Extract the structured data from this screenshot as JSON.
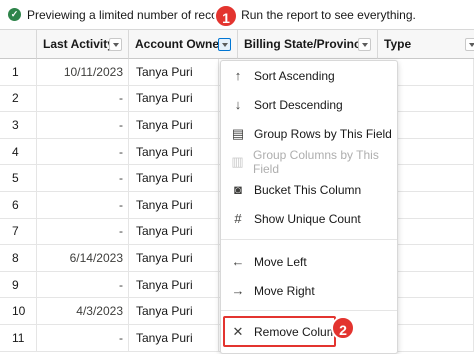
{
  "banner": {
    "message": "Previewing a limited number of records. Run the report to see everything."
  },
  "columns": {
    "last_activity": "Last Activity",
    "account_owner": "Account Owner",
    "billing_state": "Billing State/Province",
    "type": "Type"
  },
  "rows": [
    {
      "num": "1",
      "date": "10/11/2023",
      "owner": "Tanya Puri"
    },
    {
      "num": "2",
      "date": "-",
      "owner": "Tanya Puri"
    },
    {
      "num": "3",
      "date": "-",
      "owner": "Tanya Puri"
    },
    {
      "num": "4",
      "date": "-",
      "owner": "Tanya Puri"
    },
    {
      "num": "5",
      "date": "-",
      "owner": "Tanya Puri"
    },
    {
      "num": "6",
      "date": "-",
      "owner": "Tanya Puri"
    },
    {
      "num": "7",
      "date": "-",
      "owner": "Tanya Puri"
    },
    {
      "num": "8",
      "date": "6/14/2023",
      "owner": "Tanya Puri"
    },
    {
      "num": "9",
      "date": "-",
      "owner": "Tanya Puri"
    },
    {
      "num": "10",
      "date": "4/3/2023",
      "owner": "Tanya Puri"
    },
    {
      "num": "11",
      "date": "-",
      "owner": "Tanya Puri"
    }
  ],
  "menu": {
    "sort_ascending": "Sort Ascending",
    "sort_descending": "Sort Descending",
    "group_rows": "Group Rows by This Field",
    "group_columns": "Group Columns by This Field",
    "bucket": "Bucket This Column",
    "unique_count": "Show Unique Count",
    "move_left": "Move Left",
    "move_right": "Move Right",
    "remove_column": "Remove Column"
  },
  "callouts": {
    "step1": "1",
    "step2": "2"
  },
  "icons": {
    "banner": "check-circle-icon",
    "header_dropdown": "chevron-down-icon",
    "sort_ascending": "arrow-up-icon",
    "sort_descending": "arrow-down-icon",
    "group_rows": "group-rows-icon",
    "group_columns": "group-columns-icon",
    "bucket": "bucket-icon",
    "unique_count": "unique-count-icon",
    "move_left": "arrow-left-icon",
    "move_right": "arrow-right-icon",
    "remove_column": "close-icon"
  },
  "colors": {
    "callout": "#e3342f",
    "success": "#2e844a",
    "accent": "#0176d3"
  }
}
